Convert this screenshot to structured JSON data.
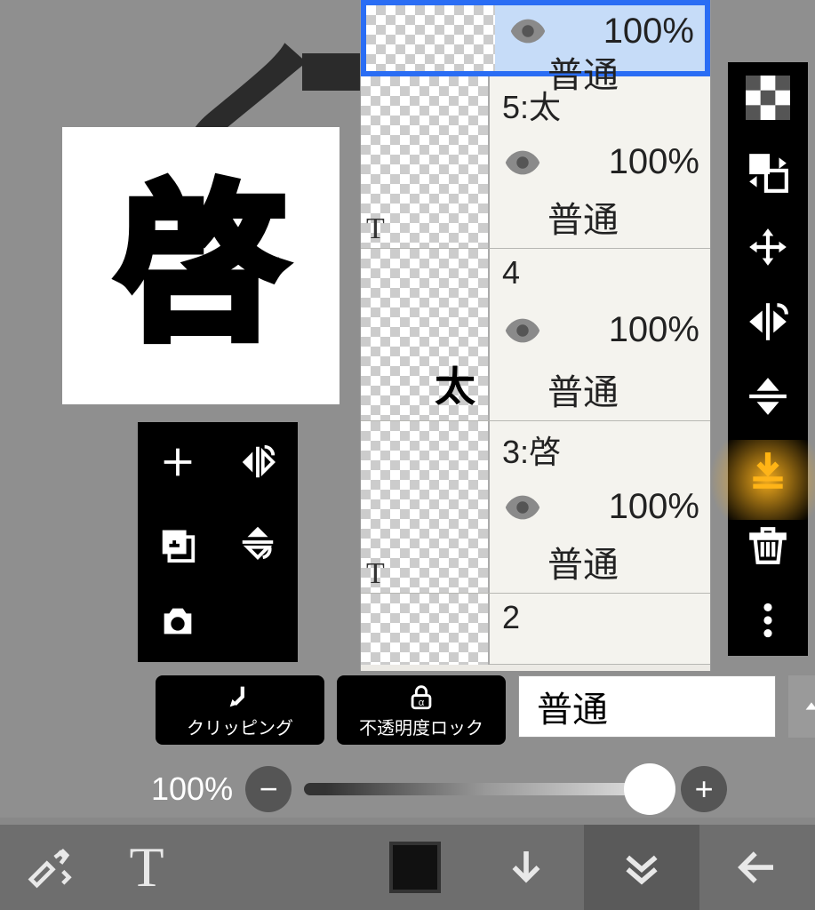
{
  "canvas": {
    "tile_big_char": "啓",
    "tile_small_char": "太"
  },
  "mini_palette": {
    "add": "add-layer",
    "flip": "flip-horizontal",
    "add_folder": "add-folder",
    "flip_v": "flip-vertical",
    "camera": "camera"
  },
  "layers": [
    {
      "name": "",
      "opacity": "100%",
      "blend": "普通",
      "text_layer": false,
      "selected": true
    },
    {
      "name": "5:太",
      "opacity": "100%",
      "blend": "普通",
      "text_layer": true,
      "selected": false
    },
    {
      "name": "4",
      "opacity": "100%",
      "blend": "普通",
      "text_layer": false,
      "selected": false
    },
    {
      "name": "3:啓",
      "opacity": "100%",
      "blend": "普通",
      "text_layer": true,
      "selected": false
    },
    {
      "name": "2",
      "opacity": "",
      "blend": "",
      "text_layer": false,
      "selected": false
    }
  ],
  "controls": {
    "clipping_label": "クリッピング",
    "alpha_lock_label": "不透明度ロック",
    "blend_mode_value": "普通",
    "opacity_value": "100%"
  },
  "right_toolbar": {
    "items": [
      "checker",
      "swap",
      "move",
      "flip-h",
      "flip-v",
      "merge-down",
      "trash",
      "more"
    ],
    "highlight": "merge-down"
  },
  "bottom_bar": {
    "items": [
      "brush-swap",
      "text",
      "spacer",
      "color",
      "down",
      "collapse",
      "back"
    ],
    "text_label": "T"
  }
}
